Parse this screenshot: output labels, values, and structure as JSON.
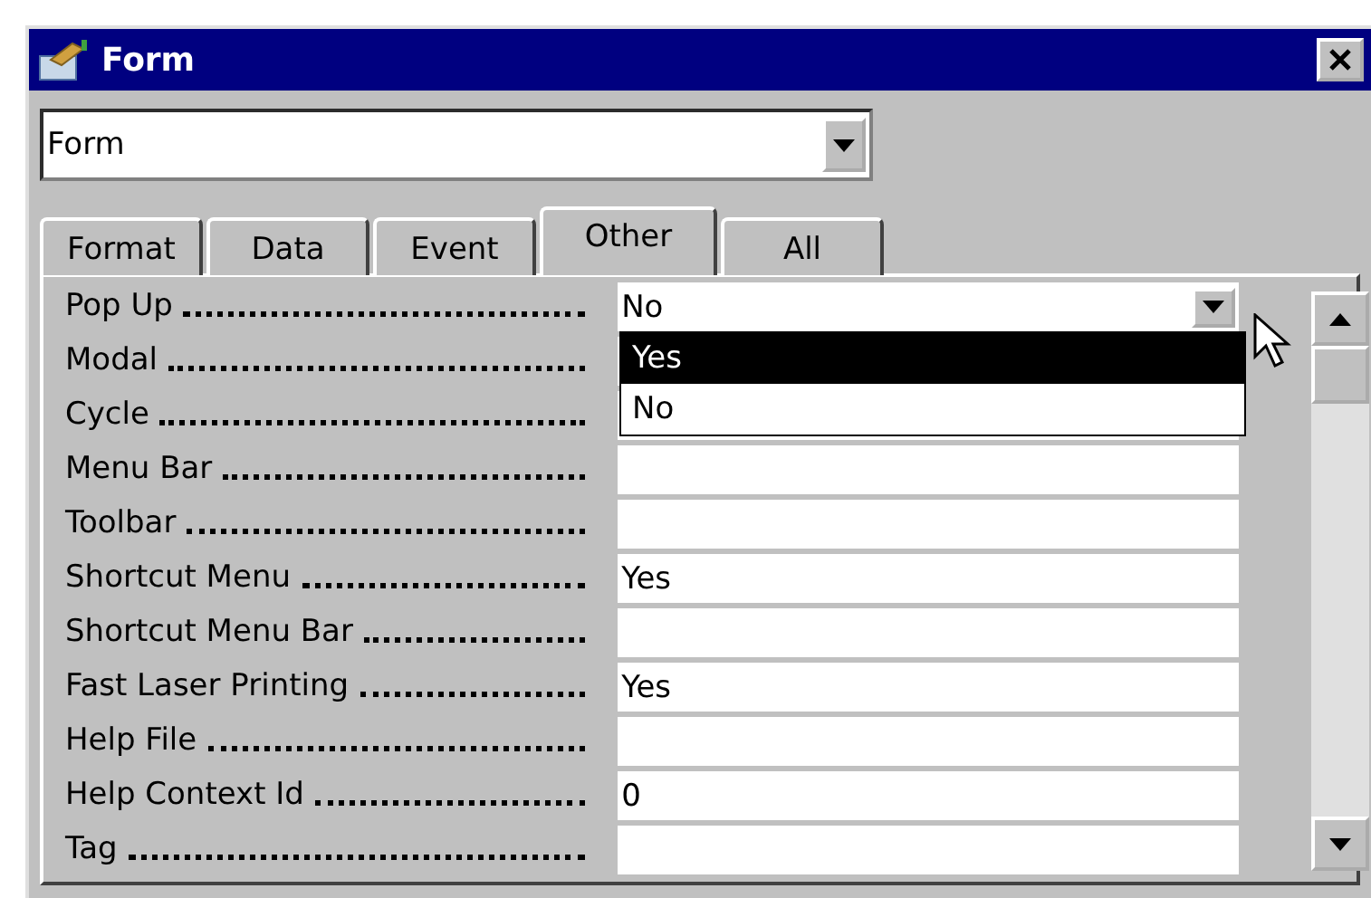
{
  "window": {
    "title": "Form"
  },
  "object_selector": {
    "value": "Form"
  },
  "tabs": [
    {
      "label": "Format",
      "selected": false
    },
    {
      "label": "Data",
      "selected": false
    },
    {
      "label": "Event",
      "selected": false
    },
    {
      "label": "Other",
      "selected": true
    },
    {
      "label": "All",
      "selected": false
    }
  ],
  "properties": [
    {
      "label": "Pop Up",
      "value": "No",
      "kind": "combo"
    },
    {
      "label": "Modal",
      "kind": "text"
    },
    {
      "label": "Cycle",
      "kind": "text"
    },
    {
      "label": "Menu Bar",
      "kind": "text"
    },
    {
      "label": "Toolbar",
      "kind": "text"
    },
    {
      "label": "Shortcut Menu",
      "value": "Yes",
      "kind": "text"
    },
    {
      "label": "Shortcut Menu Bar",
      "kind": "text"
    },
    {
      "label": "Fast Laser Printing",
      "value": "Yes",
      "kind": "text"
    },
    {
      "label": "Help File",
      "kind": "text"
    },
    {
      "label": "Help Context Id",
      "value": "0",
      "kind": "text"
    },
    {
      "label": "Tag",
      "kind": "text"
    }
  ],
  "dropdown": {
    "options": [
      {
        "label": "Yes",
        "selected": true
      },
      {
        "label": "No",
        "selected": false
      }
    ]
  }
}
